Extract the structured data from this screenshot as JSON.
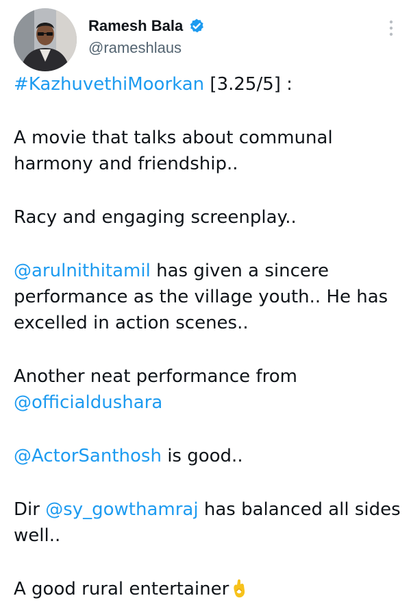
{
  "author": {
    "name": "Ramesh Bala",
    "handle": "@rameshlaus",
    "verified_color": "#1d9bf0"
  },
  "icons": {
    "verified": "verified-badge-icon",
    "more": "more-vertical-icon",
    "emoji": "ok-hand-emoji-icon"
  },
  "tweet": {
    "line1": {
      "hashtag": "#KazhuvethiMoorkan",
      "rating": " [3.25/5] :"
    },
    "line2": "A movie that talks about communal harmony and friendship..",
    "line3": "Racy and engaging screenplay..",
    "line4": {
      "mention": "@arulnithitamil",
      "text": " has given a sincere performance as the village youth.. He has excelled in action scenes.."
    },
    "line5": {
      "text": "Another neat performance from ",
      "mention": "@officialdushara"
    },
    "line6": {
      "mention": "@ActorSanthosh",
      "text": " is good.."
    },
    "line7": {
      "prefix": "Dir ",
      "mention": "@sy_gowthamraj",
      "text": " has balanced all sides well.."
    },
    "line8": "A good rural entertainer"
  }
}
